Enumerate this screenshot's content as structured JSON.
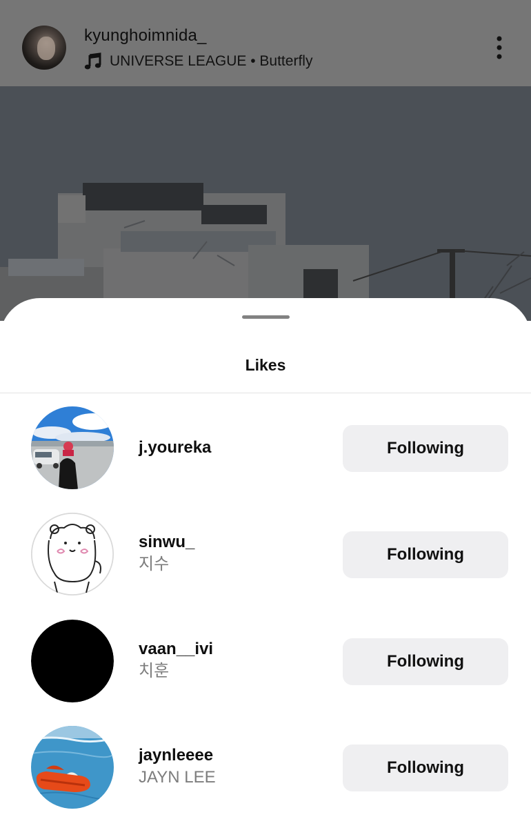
{
  "post": {
    "username": "kyunghoimnida_",
    "music": "UNIVERSE LEAGUE • Butterfly",
    "icons": {
      "music": "music-note-icon",
      "more": "more-vertical-icon"
    }
  },
  "likes_sheet": {
    "title": "Likes",
    "users": [
      {
        "username": "j.youreka",
        "fullname": "",
        "button_label": "Following"
      },
      {
        "username": "sinwu_",
        "fullname": "지수",
        "button_label": "Following"
      },
      {
        "username": "vaan__ivi",
        "fullname": "치훈",
        "button_label": "Following"
      },
      {
        "username": "jaynleeee",
        "fullname": "JAYN LEE",
        "button_label": "Following"
      }
    ]
  },
  "colors": {
    "overlay": "#767676",
    "button_bg": "#efeff1",
    "secondary_text": "#7d7d7d"
  }
}
